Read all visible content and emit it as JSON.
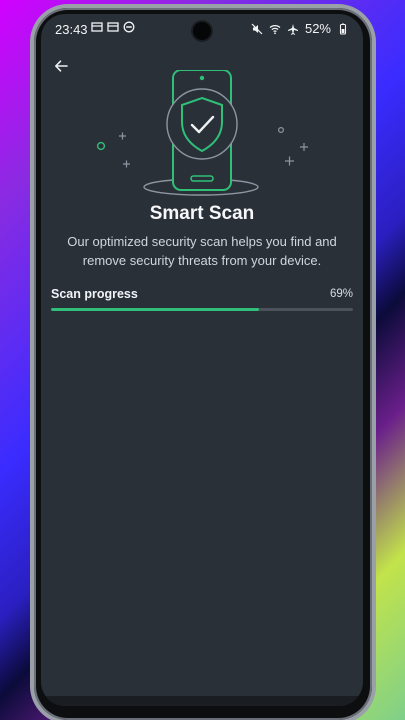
{
  "status_bar": {
    "time": "23:43",
    "battery": "52%"
  },
  "header": {
    "back_icon": "arrow-left-icon"
  },
  "hero": {
    "icon": "phone-shield-check-icon"
  },
  "content": {
    "title": "Smart Scan",
    "description": "Our optimized security scan helps you find and remove security threats from your device."
  },
  "scan": {
    "label": "Scan progress",
    "percent_text": "69%",
    "progress": 0.69
  },
  "colors": {
    "background": "#2a3038",
    "accent_green": "#2fbf79",
    "track": "#4a525c"
  }
}
